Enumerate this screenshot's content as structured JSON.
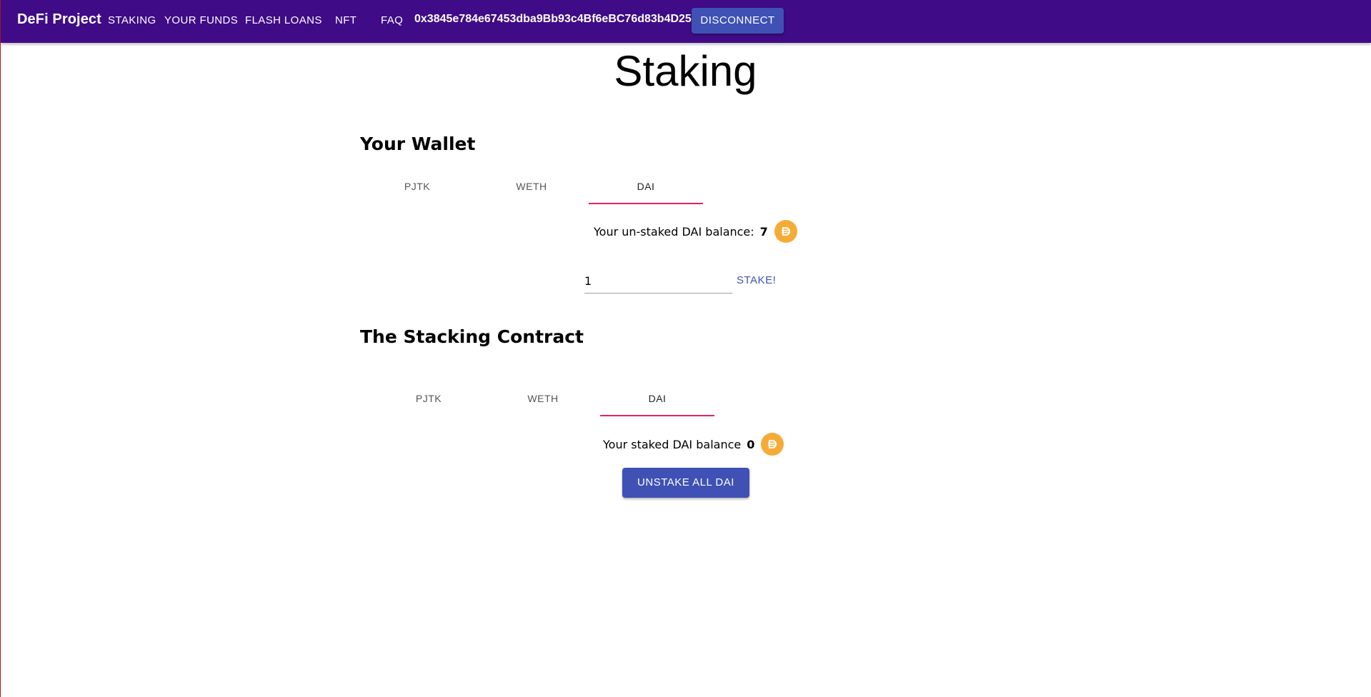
{
  "app": {
    "brand": "DeFi Project",
    "nav": [
      "STAKING",
      "YOUR FUNDS",
      "FLASH LOANS",
      "NFT",
      "FAQ"
    ],
    "address": "0x3845e784e67453dba9Bb93c4Bf6eBC76d83b4D25",
    "disconnect_label": "DISCONNECT",
    "header_color": "#3f0b87",
    "button_color": "#3f51b5"
  },
  "page": {
    "title": "Staking"
  },
  "wallet": {
    "title": "Your Wallet",
    "tabs": [
      "PJTK",
      "WETH",
      "DAI"
    ],
    "active_tab": "DAI",
    "balance_label": "Your un-staked DAI balance:",
    "balance_value": "7",
    "token_icon": "dai-coin-icon",
    "amount_value": "1",
    "stake_label": "STAKE!"
  },
  "contract": {
    "title": "The Stacking Contract",
    "tabs": [
      "PJTK",
      "WETH",
      "DAI"
    ],
    "active_tab": "DAI",
    "balance_label": "Your staked DAI balance",
    "balance_value": "0",
    "token_icon": "dai-coin-icon",
    "unstake_label": "UNSTAKE ALL DAI"
  },
  "colors": {
    "tab_indicator": "#e91e63",
    "dai_coin": "#f5ac37"
  }
}
